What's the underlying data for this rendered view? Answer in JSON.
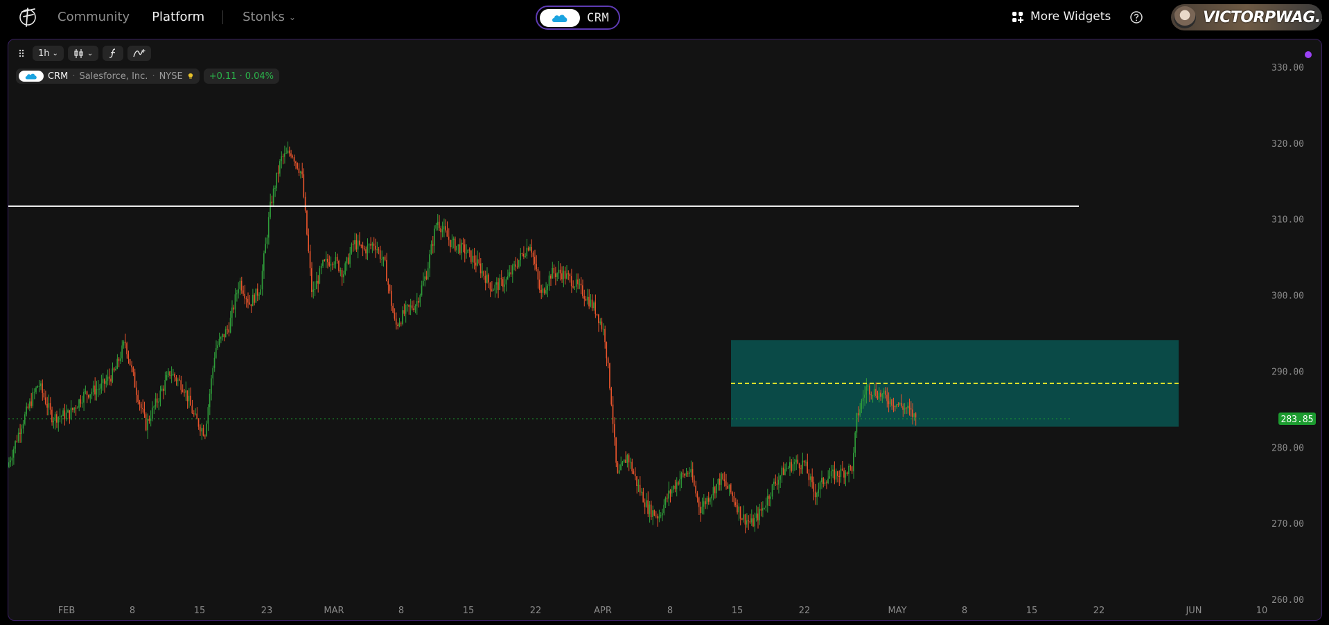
{
  "nav": {
    "community": "Community",
    "platform": "Platform",
    "stonks": "Stonks",
    "ticker": "CRM",
    "more_widgets": "More Widgets",
    "username": "VICTORPWAG..."
  },
  "toolbar": {
    "interval": "1h"
  },
  "symbol": {
    "ticker": "CRM",
    "name": "Salesforce, Inc.",
    "exchange": "NYSE",
    "change": "+0.11",
    "change_pct": "0.04%"
  },
  "colors": {
    "accent_purple": "#9b42f5",
    "up": "#2f9e3a",
    "down": "#e8542c",
    "zone": "#0a4a47",
    "last_price": "#1c9b2f"
  },
  "chart_data": {
    "type": "candlestick",
    "interval": "1h",
    "price_axis": {
      "range": [
        258,
        333
      ],
      "ticks": [
        "330.00",
        "320.00",
        "310.00",
        "300.00",
        "290.00",
        "280.00",
        "270.00",
        "260.00"
      ],
      "last_price": "283.85"
    },
    "time_axis": {
      "labels": [
        "FEB",
        "8",
        "15",
        "23",
        "MAR",
        "8",
        "15",
        "22",
        "APR",
        "8",
        "15",
        "22",
        "MAY",
        "8",
        "15",
        "22",
        "JUN",
        "10"
      ]
    },
    "horizontal_lines": [
      {
        "price": 311.8,
        "color": "#ffffff",
        "style": "solid"
      },
      {
        "price": 288.5,
        "color": "#e8e82a",
        "style": "dashed"
      },
      {
        "price": 283.85,
        "color": "#1c9b2f",
        "style": "dotted"
      }
    ],
    "zone": {
      "top": 294.2,
      "bottom": 282.8
    },
    "path_anchors": [
      [
        0,
        277.5
      ],
      [
        20,
        283
      ],
      [
        45,
        288.5
      ],
      [
        65,
        284
      ],
      [
        90,
        284.5
      ],
      [
        110,
        287
      ],
      [
        135,
        288
      ],
      [
        155,
        290
      ],
      [
        170,
        294
      ],
      [
        185,
        288
      ],
      [
        200,
        283
      ],
      [
        215,
        286
      ],
      [
        235,
        290
      ],
      [
        255,
        288
      ],
      [
        270,
        284
      ],
      [
        285,
        282
      ],
      [
        300,
        293
      ],
      [
        320,
        296
      ],
      [
        335,
        302
      ],
      [
        350,
        299
      ],
      [
        365,
        301
      ],
      [
        380,
        312
      ],
      [
        395,
        318
      ],
      [
        410,
        319
      ],
      [
        425,
        316
      ],
      [
        440,
        300
      ],
      [
        455,
        304
      ],
      [
        470,
        305
      ],
      [
        485,
        303
      ],
      [
        500,
        307
      ],
      [
        515,
        306
      ],
      [
        530,
        307
      ],
      [
        545,
        304
      ],
      [
        560,
        296
      ],
      [
        575,
        298
      ],
      [
        590,
        299
      ],
      [
        605,
        303
      ],
      [
        620,
        310
      ],
      [
        640,
        307
      ],
      [
        660,
        306
      ],
      [
        680,
        304
      ],
      [
        700,
        301
      ],
      [
        720,
        302
      ],
      [
        740,
        305
      ],
      [
        755,
        307
      ],
      [
        770,
        300
      ],
      [
        785,
        303
      ],
      [
        800,
        303
      ],
      [
        815,
        302
      ],
      [
        835,
        300
      ],
      [
        850,
        298
      ],
      [
        862,
        295
      ],
      [
        872,
        286
      ],
      [
        880,
        276
      ],
      [
        895,
        279
      ],
      [
        910,
        275
      ],
      [
        925,
        272
      ],
      [
        940,
        271
      ],
      [
        955,
        274
      ],
      [
        970,
        276
      ],
      [
        985,
        277
      ],
      [
        1000,
        272
      ],
      [
        1015,
        274
      ],
      [
        1030,
        276
      ],
      [
        1045,
        274
      ],
      [
        1060,
        271
      ],
      [
        1075,
        270
      ],
      [
        1090,
        272
      ],
      [
        1105,
        275
      ],
      [
        1120,
        277
      ],
      [
        1135,
        278
      ],
      [
        1150,
        278
      ],
      [
        1165,
        274
      ],
      [
        1180,
        276
      ],
      [
        1195,
        276.5
      ],
      [
        1210,
        277
      ],
      [
        1220,
        277.5
      ],
      [
        1226,
        284
      ],
      [
        1240,
        288
      ],
      [
        1260,
        287
      ],
      [
        1280,
        286
      ],
      [
        1300,
        285
      ],
      [
        1310,
        284
      ]
    ]
  }
}
